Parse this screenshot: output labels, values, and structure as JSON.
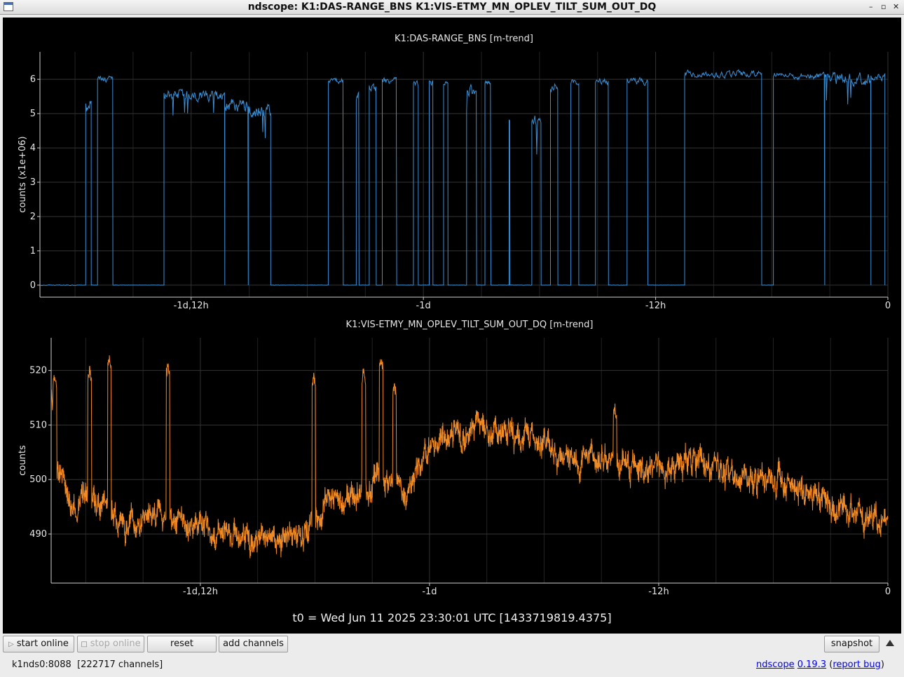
{
  "window": {
    "title": "ndscope: K1:DAS-RANGE_BNS K1:VIS-ETMY_MN_OPLEV_TILT_SUM_OUT_DQ"
  },
  "t0_label": "t0 = Wed Jun 11 2025 23:30:01 UTC [1433719819.4375]",
  "toolbar": {
    "start_online": "start online",
    "stop_online": "stop online",
    "reset": "reset",
    "add_channels": "add channels",
    "snapshot": "snapshot"
  },
  "status": {
    "server": "k1nds0:8088",
    "channels": "[222717 channels]",
    "app_name": "ndscope",
    "version": "0.19.3",
    "report_bug": "report bug"
  },
  "chart_data": [
    {
      "type": "line",
      "title": "K1:DAS-RANGE_BNS [m-trend]",
      "ylabel": "counts (x1e+06)",
      "xlim": [
        -1.8255,
        0
      ],
      "ylim": [
        -0.35,
        6.8
      ],
      "yticks": [
        0,
        1,
        2,
        3,
        4,
        5,
        6
      ],
      "xticks": [
        -1.5,
        -1,
        -0.5,
        0
      ],
      "xtick_labels": [
        "-1d,12h",
        "-1d",
        "-12h",
        "0"
      ],
      "grid": true,
      "color": "#3a8fd6",
      "x_unit": "days relative to t0",
      "segments": [
        {
          "x": [
            -1.8255,
            -1.74
          ],
          "y": 0,
          "noise": 0.02
        },
        {
          "x": [
            -1.727,
            -1.715
          ],
          "y": 5.2,
          "noise": 0.45
        },
        {
          "x": [
            -1.7015,
            -1.6685
          ],
          "y": 6.0,
          "noise": 0.15
        },
        {
          "x": [
            -1.5585,
            -1.4275
          ],
          "y": 5.55,
          "noise": 0.25
        },
        {
          "x": [
            -1.4275,
            -1.377
          ],
          "y": 5.25,
          "noise": 0.3
        },
        {
          "x": [
            -1.377,
            -1.3285
          ],
          "y": 5.1,
          "noise": 0.35
        },
        {
          "x": [
            -1.2045,
            -1.1725
          ],
          "y": 5.95,
          "noise": 0.12
        },
        {
          "x": [
            -1.1445,
            -1.1385
          ],
          "y": 5.5,
          "noise": 0.25
        },
        {
          "x": [
            -1.1165,
            -1.1015
          ],
          "y": 5.75,
          "noise": 0.2
        },
        {
          "x": [
            -1.0885,
            -1.0575
          ],
          "y": 5.95,
          "noise": 0.15
        },
        {
          "x": [
            -1.0215,
            -1.011
          ],
          "y": 5.85,
          "noise": 0.15
        },
        {
          "x": [
            -0.9875,
            -0.9795
          ],
          "y": 5.9,
          "noise": 0.15
        },
        {
          "x": [
            -0.9565,
            -0.947
          ],
          "y": 5.9,
          "noise": 0.12
        },
        {
          "x": [
            -0.907,
            -0.8855
          ],
          "y": 5.6,
          "noise": 0.3
        },
        {
          "x": [
            -0.8675,
            -0.8545
          ],
          "y": 5.9,
          "noise": 0.15
        },
        {
          "x": [
            -0.8155,
            -0.8135
          ],
          "y": 4.8,
          "noise": 0.05
        },
        {
          "x": [
            -0.7665,
            -0.7465
          ],
          "y": 4.9,
          "noise": 0.4
        },
        {
          "x": [
            -0.7265,
            -0.7105
          ],
          "y": 5.75,
          "noise": 0.25
        },
        {
          "x": [
            -0.6825,
            -0.6655
          ],
          "y": 5.9,
          "noise": 0.15
        },
        {
          "x": [
            -0.6295,
            -0.6015
          ],
          "y": 5.95,
          "noise": 0.15
        },
        {
          "x": [
            -0.5615,
            -0.5165
          ],
          "y": 5.95,
          "noise": 0.15
        },
        {
          "x": [
            -0.4375,
            -0.2715
          ],
          "y": 6.15,
          "noise": 0.15
        },
        {
          "x": [
            -0.2465,
            -0.136
          ],
          "y": 6.1,
          "noise": 0.15
        },
        {
          "x": [
            -0.136,
            -0.0365
          ],
          "y": 6.0,
          "noise": 0.3
        },
        {
          "x": [
            -0.0365,
            -0.0065
          ],
          "y": 6.05,
          "noise": 0.15
        }
      ]
    },
    {
      "type": "line",
      "title": "K1:VIS-ETMY_MN_OPLEV_TILT_SUM_OUT_DQ [m-trend]",
      "ylabel": "counts",
      "xlim": [
        -1.8255,
        0
      ],
      "ylim": [
        481,
        526
      ],
      "yticks": [
        490,
        500,
        510,
        520
      ],
      "xticks": [
        -1.5,
        -1,
        -0.5,
        0
      ],
      "xtick_labels": [
        "-1d,12h",
        "-1d",
        "-12h",
        "0"
      ],
      "grid": true,
      "color": "#f08a24",
      "x_unit": "days relative to t0",
      "baseline": [
        [
          -1.8255,
          519
        ],
        [
          -1.813,
          502
        ],
        [
          -1.78,
          495
        ],
        [
          -1.71,
          495
        ],
        [
          -1.67,
          491
        ],
        [
          -1.6,
          494
        ],
        [
          -1.52,
          492
        ],
        [
          -1.43,
          490
        ],
        [
          -1.35,
          489
        ],
        [
          -1.28,
          489
        ],
        [
          -1.22,
          496
        ],
        [
          -1.15,
          497
        ],
        [
          -1.1,
          501
        ],
        [
          -1.05,
          497
        ],
        [
          -1.0,
          507
        ],
        [
          -0.95,
          508
        ],
        [
          -0.85,
          509
        ],
        [
          -0.77,
          508
        ],
        [
          -0.7,
          504
        ],
        [
          -0.6,
          503
        ],
        [
          -0.5,
          502
        ],
        [
          -0.4,
          503
        ],
        [
          -0.3,
          500
        ],
        [
          -0.2,
          499
        ],
        [
          -0.15,
          497
        ],
        [
          -0.1,
          495
        ],
        [
          -0.05,
          494
        ],
        [
          0,
          492
        ]
      ],
      "spikes": [
        [
          -1.8175,
          519
        ],
        [
          -1.7415,
          520
        ],
        [
          -1.6985,
          522
        ],
        [
          -1.5705,
          521
        ],
        [
          -1.2525,
          519
        ],
        [
          -1.1435,
          520
        ],
        [
          -1.1055,
          522
        ],
        [
          -1.0765,
          517
        ],
        [
          -0.5955,
          513
        ]
      ]
    }
  ]
}
